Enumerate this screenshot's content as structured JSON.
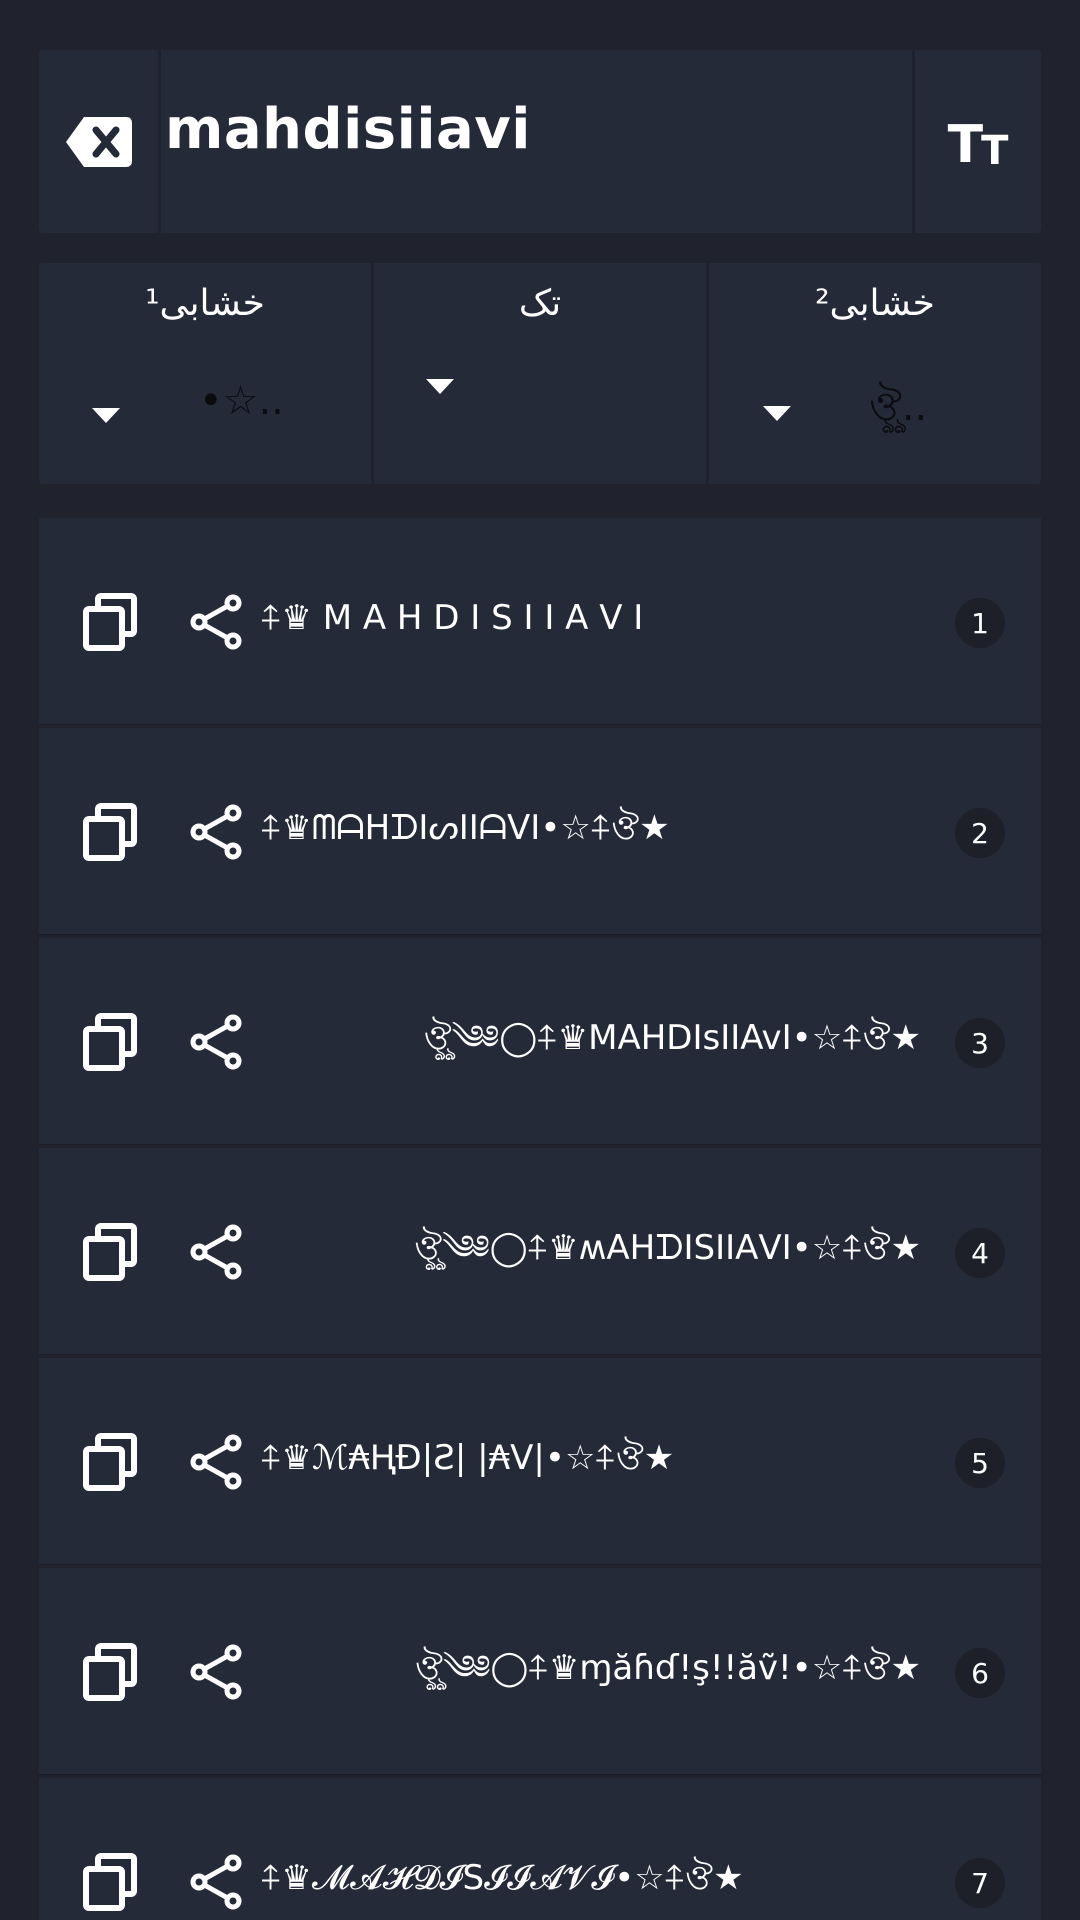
{
  "input": {
    "value": "mahdisiiavi",
    "clear_icon": "backspace-x-icon",
    "font_size_icon": "text-size-icon",
    "font_size_big": "T",
    "font_size_small": "T"
  },
  "selectors": [
    {
      "label": "خشابی¹",
      "value": "•☆..",
      "icon": "caret-down-icon"
    },
    {
      "label": "تک",
      "value": "",
      "icon": "caret-down-icon"
    },
    {
      "label": "خشابی²",
      "value": "ঔৣ..",
      "icon": "caret-down-icon"
    }
  ],
  "results": [
    {
      "index": "1",
      "text": "⍏♛ M A H D I S I I A V I"
    },
    {
      "index": "2",
      "text": "⍏♛ᗰᗩᕼᗪIᔕIIᗩᐯI•☆⍏ঔ★"
    },
    {
      "index": "3",
      "text": "ঔৣ༄༅◯⍏♛MAHDIsIIAvI•☆⍏ঔ★"
    },
    {
      "index": "4",
      "text": "ঔৣ༄༅◯⍏♛ʍΑΗᗪΙSΙΙΑVΙ•☆⍏ঔ★"
    },
    {
      "index": "5",
      "text": "⍏♛ℳ₳ⱧĐ|Ƨ| |₳V|•☆⍏ঔ★"
    },
    {
      "index": "6",
      "text": "ঔৣ༄༅◯⍏♛ɱăɦɗ!ş!!ăṽ!•☆⍏ঔ★"
    },
    {
      "index": "7",
      "text": "⍏♛𝓜𝓐𝓗𝓓𝓘S𝓘𝓘𝓐𝓥𝓘•☆⍏ঔ★"
    }
  ],
  "colors": {
    "background": "#20232e",
    "panel": "#252a39",
    "divider": "#1f2230",
    "badge": "#1d2029",
    "text": "#ffffff"
  }
}
